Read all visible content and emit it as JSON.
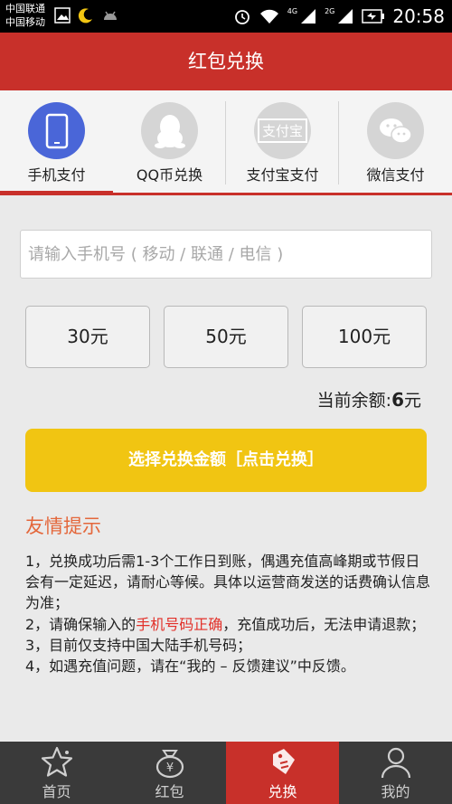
{
  "status_bar": {
    "carrier_1": "中国联通",
    "carrier_2": "中国移动",
    "net_1": "4G",
    "net_2": "2G",
    "time": "20:58"
  },
  "app_bar": {
    "title": "红包兑换"
  },
  "tabs": [
    {
      "label": "手机支付",
      "icon": "phone-icon",
      "active": true
    },
    {
      "label": "QQ币兑换",
      "icon": "qq-penguin-icon",
      "active": false
    },
    {
      "label": "支付宝支付",
      "icon": "alipay-icon",
      "icon_text": "支付宝",
      "active": false
    },
    {
      "label": "微信支付",
      "icon": "wechat-icon",
      "active": false
    }
  ],
  "phone_input": {
    "placeholder": "请输入手机号 ( 移动 / 联通 / 电信 )",
    "value": ""
  },
  "amounts": [
    "30元",
    "50元",
    "100元"
  ],
  "balance": {
    "label": "当前余额:",
    "value": "6",
    "unit": "元"
  },
  "exchange_button": "选择兑换金额［点击兑换］",
  "tips": {
    "title": "友情提示",
    "line1": "1，兑换成功后需1-3个工作日到账，偶遇充值高峰期或节假日会有一定延迟，请耐心等候。具体以运营商发送的话费确认信息为准；",
    "line2_pre": "2，请确保输入的",
    "line2_highlight": "手机号码正确",
    "line2_post": "，充值成功后，无法申请退款；",
    "line3": "3，目前仅支持中国大陆手机号码；",
    "line4": "4，如遇充值问题，请在“我的 – 反馈建议”中反馈。"
  },
  "bottom_nav": [
    {
      "label": "首页",
      "icon": "star-home-icon",
      "active": false
    },
    {
      "label": "红包",
      "icon": "money-bag-icon",
      "active": false
    },
    {
      "label": "兑换",
      "icon": "exchange-tag-icon",
      "active": true
    },
    {
      "label": "我的",
      "icon": "user-icon",
      "active": false
    }
  ],
  "colors": {
    "primary": "#c8302a",
    "accent_yellow": "#f1c512",
    "tab_active": "#4a66d8",
    "tips_title": "#e4673b"
  }
}
